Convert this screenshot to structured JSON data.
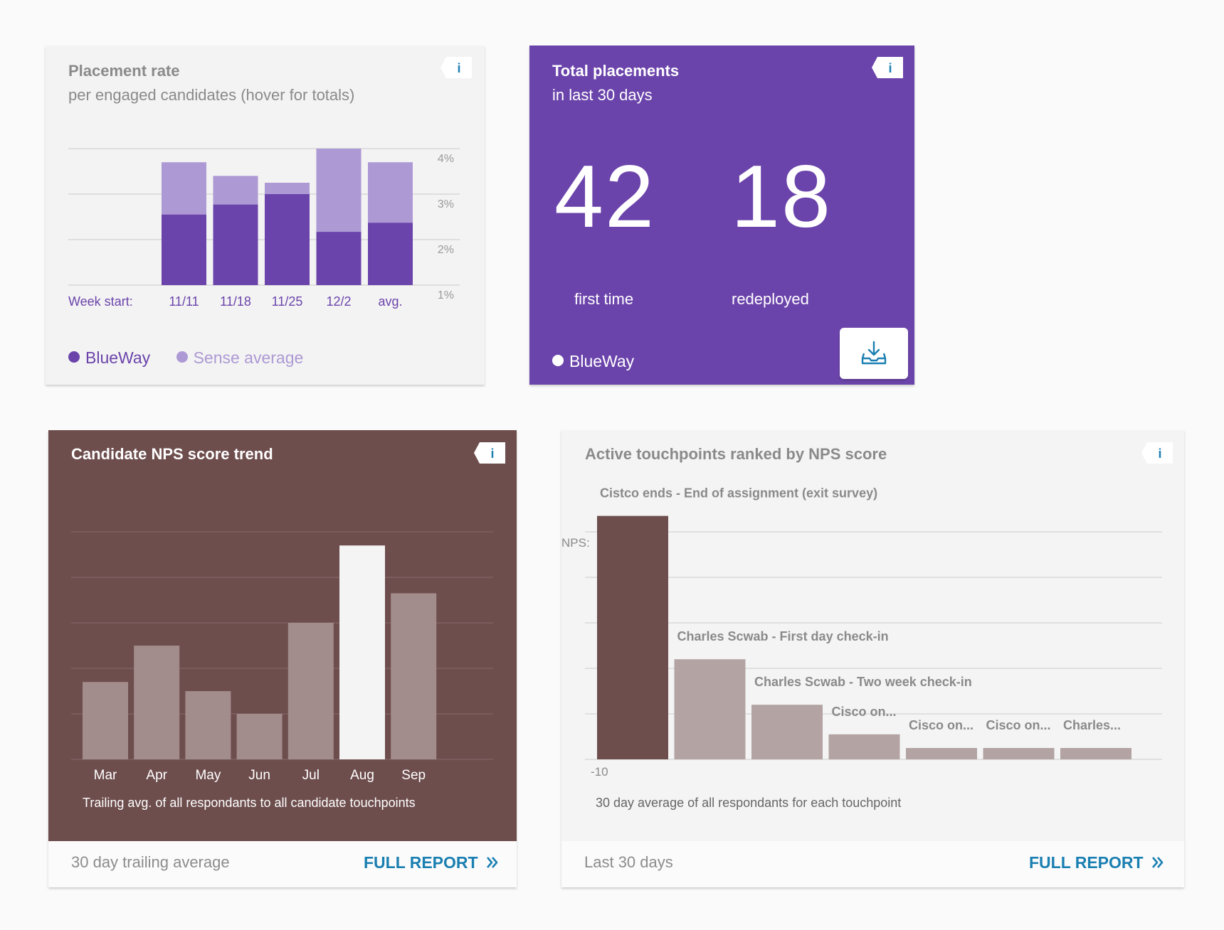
{
  "colors": {
    "purple": "#6b44ab",
    "lavender": "#ad99d4",
    "nps_brown": "#6e4d4d",
    "nps_bar": "#a38c8c",
    "nps_highlight": "#f4f4f4",
    "touch_dark": "#6e4d4d",
    "touch_bar": "#b3a3a3",
    "link_blue": "#1a7fb1"
  },
  "placement": {
    "title": "Placement rate",
    "subtitle": "per engaged candidates (hover for totals)",
    "info_icon": "info-icon",
    "week_label": "Week start:",
    "legend": {
      "primary": "BlueWay",
      "secondary": "Sense average"
    }
  },
  "total": {
    "title": "Total placements",
    "subtitle": "in last 30 days",
    "info_icon": "info-icon",
    "first_time_value": "42",
    "first_time_label": "first time",
    "redeployed_value": "18",
    "redeployed_label": "redeployed",
    "legend": "BlueWay",
    "download_icon": "download-tray-icon"
  },
  "nps": {
    "title": "Candidate NPS score trend",
    "info_icon": "info-icon",
    "footnote": "Trailing avg. of all respondants to all candidate touchpoints",
    "footer_text": "30 day trailing average",
    "full_report": "FULL REPORT",
    "full_report_icon": "double-chevron-right-icon"
  },
  "touch": {
    "title": "Active touchpoints ranked by NPS score",
    "info_icon": "info-icon",
    "footnote": "30 day average of all respondants for each touchpoint",
    "footer_text": "Last 30 days",
    "full_report": "FULL REPORT",
    "full_report_icon": "double-chevron-right-icon"
  },
  "chart_data": [
    {
      "id": "placement",
      "type": "bar",
      "categories": [
        "11/11",
        "11/18",
        "11/25",
        "12/2",
        "avg."
      ],
      "y_tick_labels": [
        "4%",
        "3%",
        "2%",
        "1%"
      ],
      "ylim": [
        1,
        4
      ],
      "grid": true,
      "legend_position": "bottom",
      "series": [
        {
          "name": "BlueWay",
          "values": [
            2.55,
            2.77,
            3.0,
            2.17,
            2.37
          ]
        },
        {
          "name": "Sense average",
          "values": [
            3.7,
            3.4,
            3.25,
            4.0,
            3.7
          ]
        }
      ]
    },
    {
      "id": "nps",
      "type": "bar",
      "categories": [
        "Mar",
        "Apr",
        "May",
        "Jun",
        "Jul",
        "Aug",
        "Sep"
      ],
      "values": [
        1.7,
        2.5,
        1.5,
        1.0,
        3.0,
        4.7,
        3.65
      ],
      "highlight_index": 5,
      "grid": true
    },
    {
      "id": "touch",
      "type": "bar",
      "y_axis_label": "NPS:",
      "y_min_label": "-10",
      "categories": [
        "Cistco ends - End of assignment (exit survey)",
        "Charles Scwab - First day check-in",
        "Charles Scwab - Two week check-in",
        "Cisco on...",
        "Cisco on...",
        "Cisco on...",
        "Charles..."
      ],
      "values": [
        5.35,
        2.2,
        1.2,
        0.55,
        0.25,
        0.25,
        0.25
      ],
      "highlight_index": 0,
      "grid": true
    }
  ]
}
